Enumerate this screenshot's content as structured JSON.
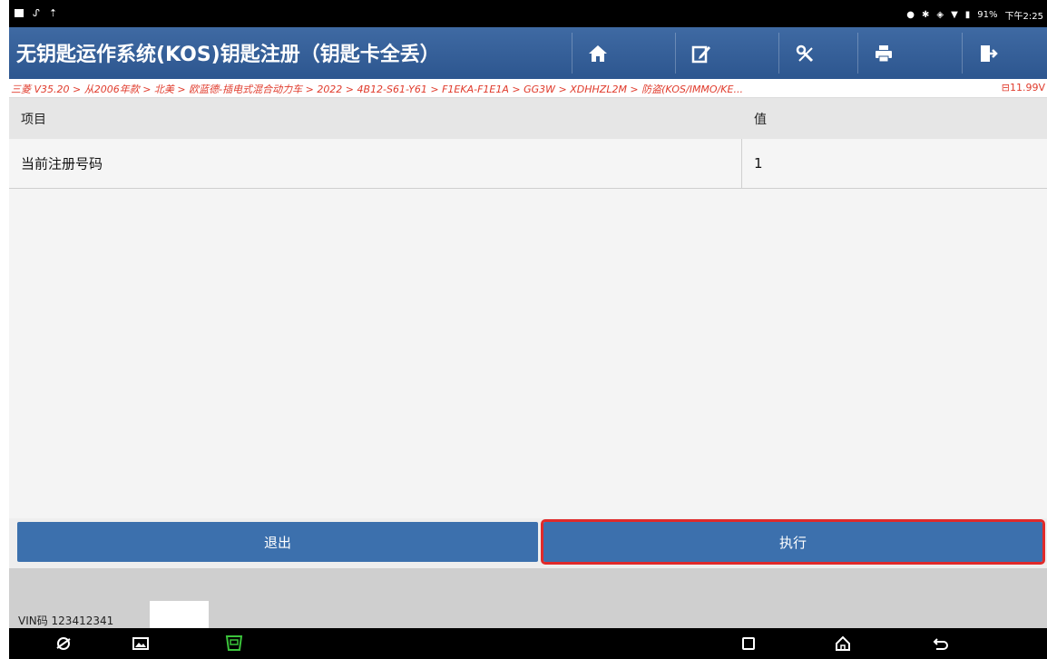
{
  "status_bar": {
    "left_icons": [
      "notification-icon",
      "signal-icon",
      "upload-icon"
    ],
    "battery": "91%",
    "time": "下午2:25"
  },
  "title_bar": {
    "title": "无钥匙运作系统(KOS)钥匙注册（钥匙卡全丢）",
    "buttons": [
      "home-icon",
      "edit-icon",
      "diagnose-icon",
      "print-icon",
      "exit-icon"
    ]
  },
  "breadcrumb": {
    "path": "三菱 V35.20 > 从2006年款 > 北美 > 欧蓝德-插电式混合动力车 > 2022 > 4B12-S61-Y61 > F1EKA-F1E1A > GG3W > XDHHZL2M > 防盗(KOS/IMMO/KE...",
    "voltage": "11.99V"
  },
  "table": {
    "headers": [
      "项目",
      "值"
    ],
    "rows": [
      {
        "item": "当前注册号码",
        "value": "1"
      }
    ]
  },
  "actions": {
    "exit_label": "退出",
    "execute_label": "执行"
  },
  "footer": {
    "vin_label": "VIN码 123412341"
  },
  "colors": {
    "title_bg": "#2f5a92",
    "button_bg": "#3c70ad",
    "highlight": "#e02a2a",
    "breadcrumb_text": "#e03b2c"
  }
}
